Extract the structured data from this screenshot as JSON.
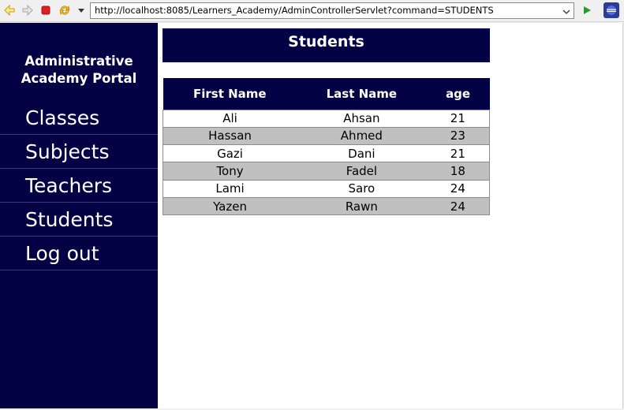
{
  "browser": {
    "url": "http://localhost:8085/Learners_Academy/AdminControllerServlet?command=STUDENTS"
  },
  "sidebar": {
    "brand_line1": "Administrative",
    "brand_line2": "Academy Portal",
    "items": [
      {
        "label": "Classes"
      },
      {
        "label": "Subjects"
      },
      {
        "label": "Teachers"
      },
      {
        "label": "Students"
      },
      {
        "label": "Log out"
      }
    ]
  },
  "main": {
    "title": "Students",
    "columns": [
      "First Name",
      "Last Name",
      "age"
    ],
    "rows": [
      {
        "first": "Ali",
        "last": "Ahsan",
        "age": "21"
      },
      {
        "first": "Hassan",
        "last": "Ahmed",
        "age": "23"
      },
      {
        "first": "Gazi",
        "last": "Dani",
        "age": "21"
      },
      {
        "first": "Tony",
        "last": "Fadel",
        "age": "18"
      },
      {
        "first": "Lami",
        "last": "Saro",
        "age": "24"
      },
      {
        "first": "Yazen",
        "last": "Rawn",
        "age": "24"
      }
    ]
  },
  "colors": {
    "navy": "#020245",
    "row_alt": "#c0c0c0"
  },
  "icons": [
    "back-icon",
    "forward-icon",
    "stop-icon",
    "refresh-icon",
    "menu-dropdown-icon",
    "url-dropdown-icon",
    "go-icon",
    "eclipse-icon"
  ]
}
